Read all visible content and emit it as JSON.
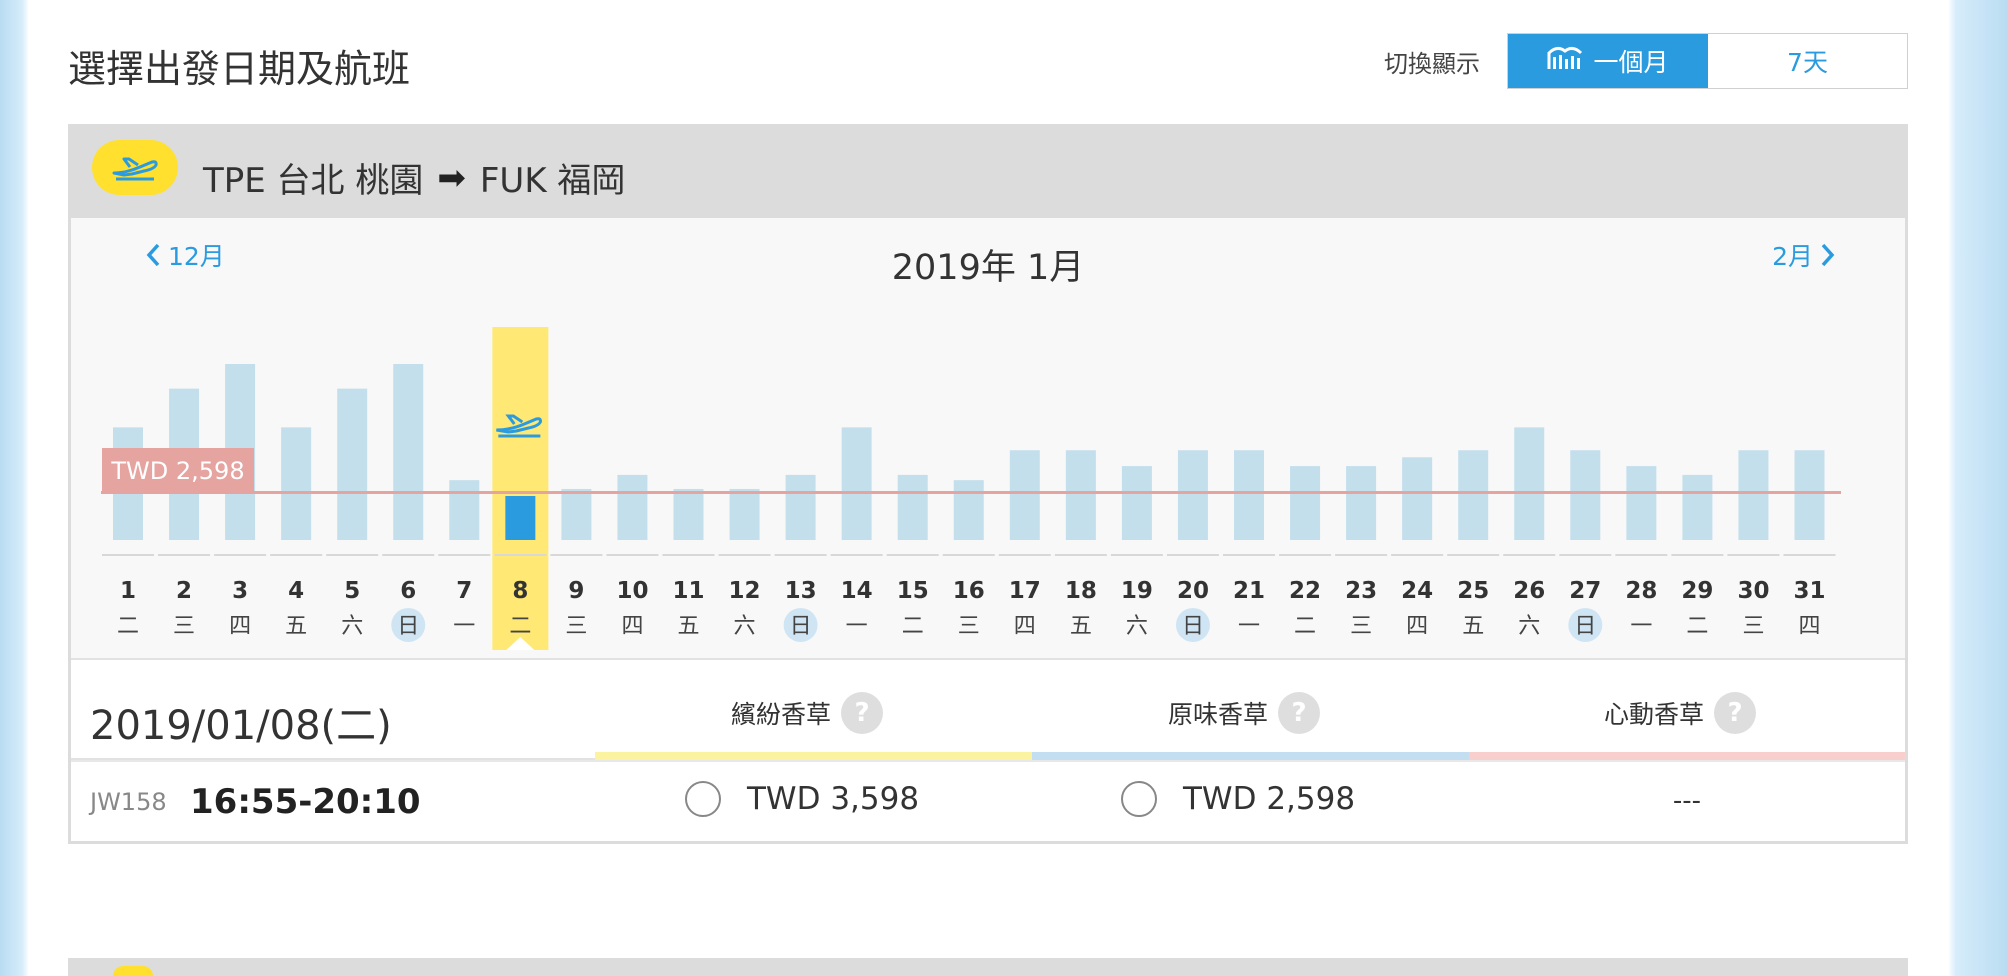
{
  "header": {
    "title": "選擇出發日期及航班",
    "switch_label": "切換顯示",
    "view_month": "一個月",
    "view_week": "7天"
  },
  "route": {
    "text": "TPE 台北 桃園",
    "dest": "FUK 福岡"
  },
  "calendar": {
    "prev_label": "12月",
    "next_label": "2月",
    "month_title": "2019年 1月",
    "price_line_label": "TWD 2,598",
    "selected_day": 8,
    "days": [
      {
        "d": "1",
        "w": "二",
        "level": 0.64,
        "sun": false
      },
      {
        "d": "2",
        "w": "三",
        "level": 0.86,
        "sun": false
      },
      {
        "d": "3",
        "w": "四",
        "level": 1.0,
        "sun": false
      },
      {
        "d": "4",
        "w": "五",
        "level": 0.64,
        "sun": false
      },
      {
        "d": "5",
        "w": "六",
        "level": 0.86,
        "sun": false
      },
      {
        "d": "6",
        "w": "日",
        "level": 1.0,
        "sun": true
      },
      {
        "d": "7",
        "w": "一",
        "level": 0.34,
        "sun": false
      },
      {
        "d": "8",
        "w": "二",
        "level": 0.25,
        "sun": false
      },
      {
        "d": "9",
        "w": "三",
        "level": 0.29,
        "sun": false
      },
      {
        "d": "10",
        "w": "四",
        "level": 0.37,
        "sun": false
      },
      {
        "d": "11",
        "w": "五",
        "level": 0.29,
        "sun": false
      },
      {
        "d": "12",
        "w": "六",
        "level": 0.29,
        "sun": false
      },
      {
        "d": "13",
        "w": "日",
        "level": 0.37,
        "sun": true
      },
      {
        "d": "14",
        "w": "一",
        "level": 0.64,
        "sun": false
      },
      {
        "d": "15",
        "w": "二",
        "level": 0.37,
        "sun": false
      },
      {
        "d": "16",
        "w": "三",
        "level": 0.34,
        "sun": false
      },
      {
        "d": "17",
        "w": "四",
        "level": 0.51,
        "sun": false
      },
      {
        "d": "18",
        "w": "五",
        "level": 0.51,
        "sun": false
      },
      {
        "d": "19",
        "w": "六",
        "level": 0.42,
        "sun": false
      },
      {
        "d": "20",
        "w": "日",
        "level": 0.51,
        "sun": true
      },
      {
        "d": "21",
        "w": "一",
        "level": 0.51,
        "sun": false
      },
      {
        "d": "22",
        "w": "二",
        "level": 0.42,
        "sun": false
      },
      {
        "d": "23",
        "w": "三",
        "level": 0.42,
        "sun": false
      },
      {
        "d": "24",
        "w": "四",
        "level": 0.47,
        "sun": false
      },
      {
        "d": "25",
        "w": "五",
        "level": 0.51,
        "sun": false
      },
      {
        "d": "26",
        "w": "六",
        "level": 0.64,
        "sun": false
      },
      {
        "d": "27",
        "w": "日",
        "level": 0.51,
        "sun": true
      },
      {
        "d": "28",
        "w": "一",
        "level": 0.42,
        "sun": false
      },
      {
        "d": "29",
        "w": "二",
        "level": 0.37,
        "sun": false
      },
      {
        "d": "30",
        "w": "三",
        "level": 0.51,
        "sun": false
      },
      {
        "d": "31",
        "w": "四",
        "level": 0.51,
        "sun": false
      }
    ],
    "price_line_level": 0.27
  },
  "detail": {
    "selected_date": "2019/01/08(二)",
    "fares": [
      {
        "name": "繽紛香草",
        "color": "#fcf3a0"
      },
      {
        "name": "原味香草",
        "color": "#c3def1"
      },
      {
        "name": "心動香草",
        "color": "#f8cfcd"
      }
    ],
    "question_mark": "?",
    "flight": {
      "number": "JW158",
      "time": "16:55-20:10",
      "price_1": "TWD 3,598",
      "price_2": "TWD 2,598",
      "price_3": "---"
    }
  },
  "colors": {
    "accent_blue": "#2b9be0",
    "bar": "#c3dfec",
    "selected_bar": "#2b9be0",
    "selected_highlight": "#ffe873",
    "price_line": "#e6a4a0",
    "plane_yellow": "#ffe02e"
  },
  "icons": {
    "plane": "airplane-takeoff-icon",
    "calendar_chart": "bar-chart-icon",
    "prev": "chevron-left-icon",
    "next": "chevron-right-icon"
  }
}
